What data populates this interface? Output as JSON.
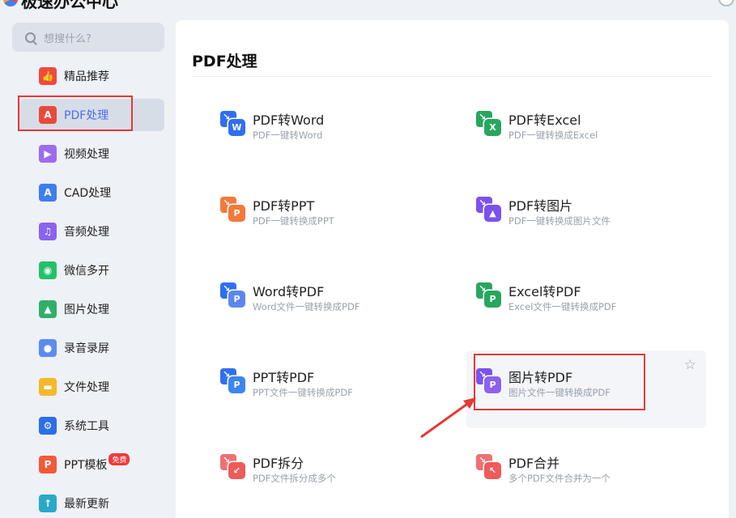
{
  "window": {
    "title": "极速办公中心"
  },
  "search": {
    "placeholder": "想搜什么?"
  },
  "sidebar": {
    "items": [
      {
        "label": "精品推荐",
        "icon": "thumbs-up-icon",
        "color": "#f04a3e",
        "glyph": "👍"
      },
      {
        "label": "PDF处理",
        "icon": "pdf-icon",
        "color": "#e84a3a",
        "glyph": "A"
      },
      {
        "label": "视频处理",
        "icon": "play-icon",
        "color": "#9b6cf0",
        "glyph": "▶"
      },
      {
        "label": "CAD处理",
        "icon": "cad-icon",
        "color": "#3e7df0",
        "glyph": "A"
      },
      {
        "label": "音频处理",
        "icon": "music-icon",
        "color": "#8a63ef",
        "glyph": "♫"
      },
      {
        "label": "微信多开",
        "icon": "wechat-icon",
        "color": "#24c06a",
        "glyph": "◉"
      },
      {
        "label": "图片处理",
        "icon": "image-icon",
        "color": "#2fb06a",
        "glyph": "▲"
      },
      {
        "label": "录音录屏",
        "icon": "microphone-icon",
        "color": "#5a8cf0",
        "glyph": "●"
      },
      {
        "label": "文件处理",
        "icon": "folder-icon",
        "color": "#f4b82a",
        "glyph": "▬"
      },
      {
        "label": "系统工具",
        "icon": "gear-icon",
        "color": "#2b6fe8",
        "glyph": "⚙"
      },
      {
        "label": "PPT模板",
        "icon": "ppt-icon",
        "color": "#f25a36",
        "glyph": "P",
        "badge": "免费"
      },
      {
        "label": "最新更新",
        "icon": "upload-icon",
        "color": "#2aa8c8",
        "glyph": "↑"
      }
    ]
  },
  "main": {
    "title": "PDF处理",
    "tools": [
      {
        "name": "PDF转Word",
        "desc": "PDF一键转Word",
        "back": "#2f6ff0",
        "front": "#2f6ff0",
        "letter": "W",
        "icon": "pdf-to-word-icon"
      },
      {
        "name": "PDF转Excel",
        "desc": "PDF一键转换成Excel",
        "back": "#27a65e",
        "front": "#27a65e",
        "letter": "X",
        "icon": "pdf-to-excel-icon"
      },
      {
        "name": "PDF转PPT",
        "desc": "PDF一键转换成PPT",
        "back": "#f5793a",
        "front": "#f5793a",
        "letter": "P",
        "icon": "pdf-to-ppt-icon"
      },
      {
        "name": "PDF转图片",
        "desc": "PDF一键转换成图片文件",
        "back": "#7b52ee",
        "front": "#7b52ee",
        "letter": "▲",
        "icon": "pdf-to-image-icon"
      },
      {
        "name": "Word转PDF",
        "desc": "Word文件一键转换成PDF",
        "back": "#2f6ff0",
        "front": "#5c87f2",
        "letter": "P",
        "icon": "word-to-pdf-icon"
      },
      {
        "name": "Excel转PDF",
        "desc": "Excel文件一键转换成PDF",
        "back": "#27a65e",
        "front": "#27a65e",
        "letter": "P",
        "icon": "excel-to-pdf-icon"
      },
      {
        "name": "PPT转PDF",
        "desc": "PPT文件一键转换成PDF",
        "back": "#2f6ff0",
        "front": "#3b86f0",
        "letter": "P",
        "icon": "ppt-to-pdf-icon"
      },
      {
        "name": "图片转PDF",
        "desc": "图片文件一键转换成PDF",
        "back": "#7b52ee",
        "front": "#8a63ef",
        "letter": "P",
        "icon": "image-to-pdf-icon"
      },
      {
        "name": "PDF拆分",
        "desc": "PDF文件拆分成多个",
        "back": "#f07070",
        "front": "#ef5a5a",
        "letter": "↙",
        "icon": "pdf-split-icon"
      },
      {
        "name": "PDF合并",
        "desc": "多个PDF文件合并为一个",
        "back": "#f07070",
        "front": "#ef5a5a",
        "letter": "↖",
        "icon": "pdf-merge-icon"
      }
    ]
  },
  "colors": {
    "accent": "#4a6ff0",
    "annotation": "#e53935"
  }
}
